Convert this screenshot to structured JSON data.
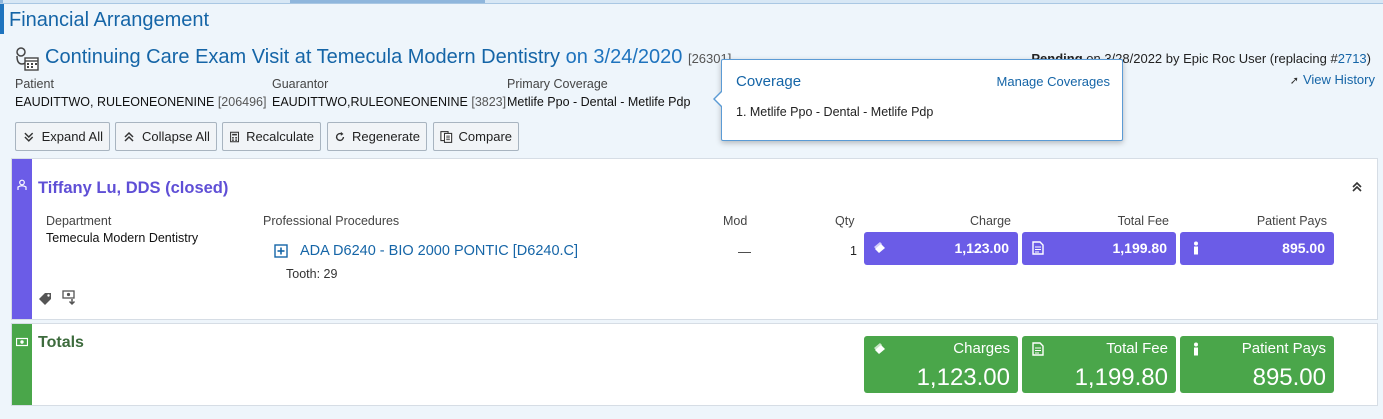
{
  "app": {
    "title": "Financial Arrangement"
  },
  "visit": {
    "name": "Continuing Care Exam Visit at Temecula Modern Dentistry",
    "on_date": "on 3/24/2020",
    "id": "[26301]"
  },
  "status": {
    "label": "Pending",
    "rest": " on 3/28/2022 by Epic Roc User (replacing #",
    "replacing_id": "2713",
    "close": ")",
    "view_history": "View History"
  },
  "header": {
    "patient_label": "Patient",
    "patient_value": "EAUDITTWO, RULEONEONENINE",
    "patient_id": "[206496]",
    "guarantor_label": "Guarantor",
    "guarantor_value": "EAUDITTWO,RULEONEONENINE",
    "guarantor_id": "[3823]",
    "coverage_label": "Primary Coverage",
    "coverage_value": "Metlife Ppo - Dental - Metlife Pdp"
  },
  "toolbar": {
    "expand_all": "Expand All",
    "collapse_all": "Collapse All",
    "recalculate": "Recalculate",
    "regenerate": "Regenerate",
    "compare": "Compare"
  },
  "coverage_popover": {
    "title": "Coverage",
    "manage": "Manage Coverages",
    "items": [
      "1. Metlife Ppo - Dental - Metlife Pdp"
    ]
  },
  "provider": {
    "name": "Tiffany Lu, DDS (closed)",
    "columns": {
      "department": "Department",
      "procedures": "Professional Procedures",
      "mod": "Mod",
      "qty": "Qty",
      "charge": "Charge",
      "total_fee": "Total Fee",
      "patient_pays": "Patient Pays"
    },
    "department_value": "Temecula Modern Dentistry",
    "procedure": {
      "name": "ADA D6240 - BIO 2000 PONTIC [D6240.C]",
      "tooth": "Tooth: 29",
      "mod": "—",
      "qty": "1",
      "charge": "1,123.00",
      "total_fee": "1,199.80",
      "patient_pays": "895.00"
    }
  },
  "totals": {
    "label": "Totals",
    "charges_label": "Charges",
    "charges_value": "1,123.00",
    "total_fee_label": "Total Fee",
    "total_fee_value": "1,199.80",
    "patient_pays_label": "Patient Pays",
    "patient_pays_value": "895.00"
  },
  "colors": {
    "provider_accent": "#6b5ce7",
    "totals_accent": "#4aa64a",
    "link": "#1565a7"
  },
  "icons": [
    "visit-calendar-icon",
    "expand-all-icon",
    "collapse-all-icon",
    "calculator-icon",
    "regenerate-icon",
    "compare-icon",
    "provider-icon",
    "collapse-section-icon",
    "add-procedure-icon",
    "money-stack-icon",
    "document-icon",
    "person-icon",
    "tag-icon",
    "money-down-icon",
    "cash-icon",
    "view-history-icon"
  ]
}
